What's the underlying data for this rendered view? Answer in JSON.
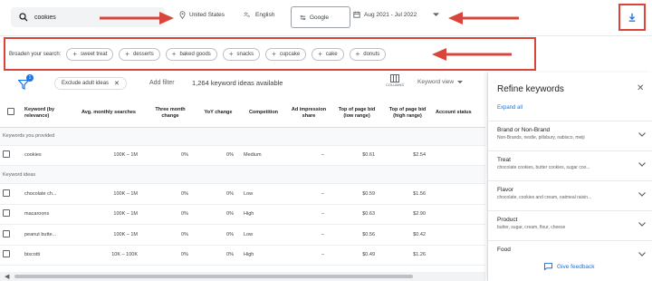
{
  "search": {
    "value": "cookies"
  },
  "top_bar": {
    "location": "United States",
    "language": "English",
    "network": "Google",
    "date_range": "Aug 2021 - Jul 2022"
  },
  "broaden": {
    "label": "Broaden your search:",
    "chips": [
      "sweet treat",
      "desserts",
      "baked goods",
      "snacks",
      "cupcake",
      "cake",
      "donuts"
    ]
  },
  "toolbar": {
    "filter_badge": "1",
    "exclude_chip": "Exclude adult ideas",
    "add_filter": "Add filter",
    "idea_count": "1,264 keyword ideas available",
    "columns_label": "COLUMNS",
    "keyword_view": "Keyword view"
  },
  "table": {
    "headers": [
      "Keyword (by relevance)",
      "Avg. monthly searches",
      "Three month change",
      "YoY change",
      "Competition",
      "Ad impression share",
      "Top of page bid (low range)",
      "Top of page bid (high range)",
      "Account status"
    ],
    "section_provided": "Keywords you provided",
    "provided_rows": [
      {
        "keyword": "cookies",
        "searches": "100K – 1M",
        "three_month": "0%",
        "yoy": "0%",
        "competition": "Medium",
        "impression": "–",
        "bid_low": "$0.61",
        "bid_high": "$2.54"
      }
    ],
    "section_ideas": "Keyword ideas",
    "idea_rows": [
      {
        "keyword": "chocolate ch...",
        "searches": "100K – 1M",
        "three_month": "0%",
        "yoy": "0%",
        "competition": "Low",
        "impression": "–",
        "bid_low": "$0.59",
        "bid_high": "$1.56"
      },
      {
        "keyword": "macaroons",
        "searches": "100K – 1M",
        "three_month": "0%",
        "yoy": "0%",
        "competition": "High",
        "impression": "–",
        "bid_low": "$0.63",
        "bid_high": "$2.90"
      },
      {
        "keyword": "peanut butte...",
        "searches": "100K – 1M",
        "three_month": "0%",
        "yoy": "0%",
        "competition": "Low",
        "impression": "–",
        "bid_low": "$0.56",
        "bid_high": "$0.42"
      },
      {
        "keyword": "biscotti",
        "searches": "10K – 100K",
        "three_month": "0%",
        "yoy": "0%",
        "competition": "High",
        "impression": "–",
        "bid_low": "$0.49",
        "bid_high": "$1.26"
      }
    ]
  },
  "refine": {
    "title": "Refine keywords",
    "expand_all": "Expand all",
    "items": [
      {
        "name": "Brand or Non-Brand",
        "sub": "Non-Brands, nestle, pillsbury, nabisco, meiji"
      },
      {
        "name": "Treat",
        "sub": "chocolate cookies, butter cookies, sugar coo..."
      },
      {
        "name": "Flavor",
        "sub": "chocolate, cookies and cream, oatmeal raisin..."
      },
      {
        "name": "Product",
        "sub": "butter, sugar, cream, flour, cheese"
      },
      {
        "name": "Food",
        "sub": ""
      }
    ],
    "feedback": "Give feedback"
  },
  "colors": {
    "accent": "#1a73e8",
    "annotation": "#d9453a"
  }
}
